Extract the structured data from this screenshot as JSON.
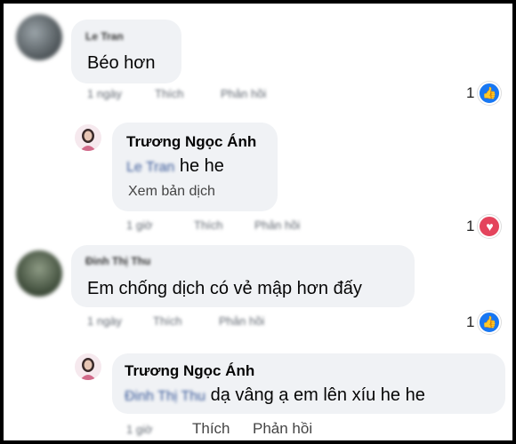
{
  "comments": [
    {
      "author": "Le Tran",
      "text": "Béo hơn",
      "time": "1 ngày",
      "like_label": "Thích",
      "reply_label": "Phản hồi",
      "reaction_count": "1",
      "reaction_icon": "like-icon"
    },
    {
      "author": "Trương Ngọc Ánh",
      "mention": "Le Tran",
      "text": "he he",
      "translate": "Xem bản dịch",
      "time": "1 giờ",
      "like_label": "Thích",
      "reply_label": "Phản hồi",
      "reaction_count": "1",
      "reaction_icon": "love-icon"
    },
    {
      "author": "Đinh Thị Thu",
      "text": "Em chống dịch có vẻ mập hơn đấy",
      "time": "1 ngày",
      "like_label": "Thích",
      "reply_label": "Phản hồi",
      "reaction_count": "1",
      "reaction_icon": "like-icon"
    },
    {
      "author": "Trương Ngọc Ánh",
      "mention": "Đinh Thị Thu",
      "text": "dạ vâng ạ em lên xíu he he",
      "time": "1 giờ",
      "like_label": "Thích",
      "reply_label": "Phản hồi"
    }
  ],
  "colors": {
    "like": "#1877f2",
    "love": "#e4445c",
    "bubble": "#f0f2f5"
  }
}
